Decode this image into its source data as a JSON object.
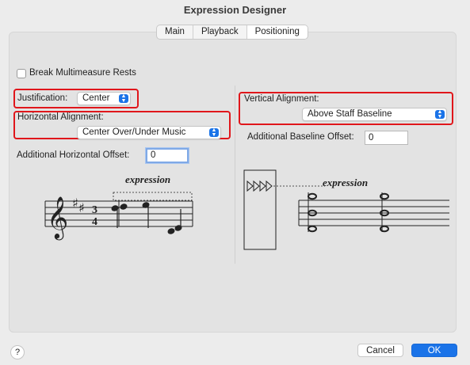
{
  "window": {
    "title": "Expression Designer"
  },
  "tabs": [
    {
      "label": "Main",
      "active": false
    },
    {
      "label": "Playback",
      "active": false
    },
    {
      "label": "Positioning",
      "active": true
    }
  ],
  "left": {
    "break_rests_label": "Break Multimeasure Rests",
    "break_rests_checked": false,
    "justification_label": "Justification:",
    "justification_value": "Center",
    "horizontal_alignment_label": "Horizontal Alignment:",
    "horizontal_alignment_value": "Center Over/Under Music",
    "horizontal_offset_label": "Additional Horizontal Offset:",
    "horizontal_offset_value": "0",
    "preview_text": "expression"
  },
  "right": {
    "vertical_alignment_label": "Vertical Alignment:",
    "vertical_alignment_value": "Above Staff Baseline",
    "baseline_offset_label": "Additional Baseline Offset:",
    "baseline_offset_value": "0",
    "preview_text": "expression"
  },
  "footer": {
    "help_label": "?",
    "cancel_label": "Cancel",
    "ok_label": "OK"
  },
  "colors": {
    "accent": "#1a73e8",
    "highlight_box": "#e0161b"
  },
  "icons": [
    "popup-stepper-icon",
    "treble-clef-icon",
    "help-icon"
  ]
}
